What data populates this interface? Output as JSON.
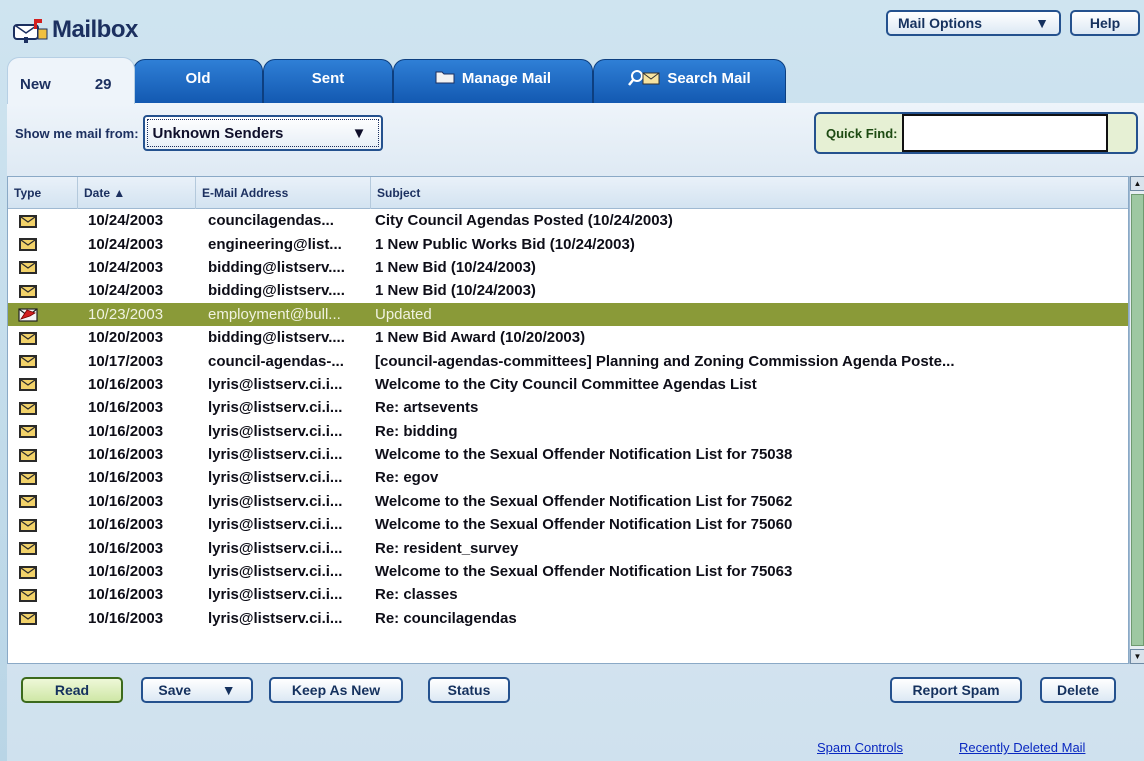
{
  "header": {
    "title": "Mailbox",
    "mail_options": "Mail Options",
    "help": "Help"
  },
  "tabs": {
    "new_label": "New",
    "new_count": "29",
    "old": "Old",
    "sent": "Sent",
    "manage": "Manage Mail",
    "search": "Search Mail"
  },
  "filter": {
    "label": "Show me mail from:",
    "selected": "Unknown Senders"
  },
  "quickfind": {
    "label": "Quick Find:",
    "value": ""
  },
  "table": {
    "columns": [
      "Type",
      "Date ▲",
      "E-Mail Address",
      "Subject"
    ],
    "rows": [
      {
        "type": "unread",
        "date": "10/24/2003",
        "email": "councilagendas...",
        "subject": "City Council Agendas Posted (10/24/2003)"
      },
      {
        "type": "unread",
        "date": "10/24/2003",
        "email": "engineering@list...",
        "subject": "1 New Public Works Bid (10/24/2003)"
      },
      {
        "type": "unread",
        "date": "10/24/2003",
        "email": "bidding@listserv....",
        "subject": "1 New Bid (10/24/2003)"
      },
      {
        "type": "unread",
        "date": "10/24/2003",
        "email": "bidding@listserv....",
        "subject": "1 New Bid (10/24/2003)"
      },
      {
        "type": "flagged",
        "date": "10/23/2003",
        "email": "employment@bull...",
        "subject": "Updated",
        "selected": true
      },
      {
        "type": "unread",
        "date": "10/20/2003",
        "email": "bidding@listserv....",
        "subject": "1 New Bid Award (10/20/2003)"
      },
      {
        "type": "unread",
        "date": "10/17/2003",
        "email": "council-agendas-...",
        "subject": "[council-agendas-committees] Planning and Zoning Commission Agenda Poste..."
      },
      {
        "type": "unread",
        "date": "10/16/2003",
        "email": "lyris@listserv.ci.i...",
        "subject": "Welcome to the City Council Committee Agendas List"
      },
      {
        "type": "unread",
        "date": "10/16/2003",
        "email": "lyris@listserv.ci.i...",
        "subject": "Re: artsevents"
      },
      {
        "type": "unread",
        "date": "10/16/2003",
        "email": "lyris@listserv.ci.i...",
        "subject": "Re: bidding"
      },
      {
        "type": "unread",
        "date": "10/16/2003",
        "email": "lyris@listserv.ci.i...",
        "subject": "Welcome to the Sexual Offender Notification List for 75038"
      },
      {
        "type": "unread",
        "date": "10/16/2003",
        "email": "lyris@listserv.ci.i...",
        "subject": "Re: egov"
      },
      {
        "type": "unread",
        "date": "10/16/2003",
        "email": "lyris@listserv.ci.i...",
        "subject": "Welcome to the Sexual Offender Notification List for 75062"
      },
      {
        "type": "unread",
        "date": "10/16/2003",
        "email": "lyris@listserv.ci.i...",
        "subject": "Welcome to the Sexual Offender Notification List for 75060"
      },
      {
        "type": "unread",
        "date": "10/16/2003",
        "email": "lyris@listserv.ci.i...",
        "subject": "Re: resident_survey"
      },
      {
        "type": "unread",
        "date": "10/16/2003",
        "email": "lyris@listserv.ci.i...",
        "subject": "Welcome to the Sexual Offender Notification List for 75063"
      },
      {
        "type": "unread",
        "date": "10/16/2003",
        "email": "lyris@listserv.ci.i...",
        "subject": "Re: classes"
      },
      {
        "type": "unread",
        "date": "10/16/2003",
        "email": "lyris@listserv.ci.i...",
        "subject": "Re: councilagendas"
      }
    ]
  },
  "actions": {
    "read": "Read",
    "save": "Save",
    "keep_as_new": "Keep As New",
    "status": "Status",
    "report_spam": "Report Spam",
    "delete": "Delete"
  },
  "links": {
    "spam_controls": "Spam Controls",
    "recently_deleted": "Recently Deleted Mail"
  },
  "colors": {
    "tab_blue": "#1a65c0",
    "selected_row": "#8a9a38",
    "link": "#0a28c0"
  }
}
